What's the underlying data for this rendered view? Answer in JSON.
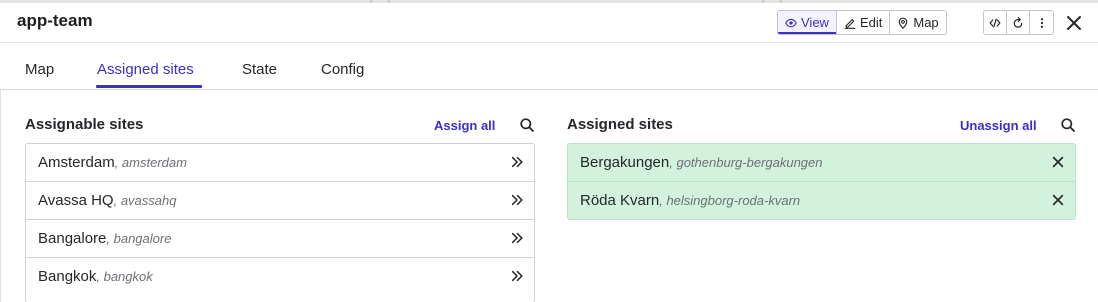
{
  "app": {
    "title": "app-team"
  },
  "view_switch": [
    {
      "label": "View",
      "icon": "eye-icon",
      "active": true
    },
    {
      "label": "Edit",
      "icon": "pencil-icon",
      "active": false
    },
    {
      "label": "Map",
      "icon": "map-pin-icon",
      "active": false
    }
  ],
  "toolbar_icons": [
    "code-icon",
    "refresh-icon",
    "more-vertical-icon"
  ],
  "tabs": [
    {
      "label": "Map",
      "active": false
    },
    {
      "label": "Assigned sites",
      "active": true
    },
    {
      "label": "State",
      "active": false
    },
    {
      "label": "Config",
      "active": false
    }
  ],
  "assignable": {
    "title": "Assignable sites",
    "action_label": "Assign all",
    "items": [
      {
        "name": "Amsterdam",
        "slug": ", amsterdam"
      },
      {
        "name": "Avassa HQ",
        "slug": ", avassahq"
      },
      {
        "name": "Bangalore",
        "slug": ", bangalore"
      },
      {
        "name": "Bangkok",
        "slug": ", bangkok"
      }
    ]
  },
  "assigned": {
    "title": "Assigned sites",
    "action_label": "Unassign all",
    "items": [
      {
        "name": "Bergakungen",
        "slug": ", gothenburg-bergakungen"
      },
      {
        "name": "Röda Kvarn",
        "slug": ", helsingborg-roda-kvarn"
      }
    ]
  },
  "colors": {
    "accent": "#3b2fc9",
    "assigned_row_bg": "#d2f2de",
    "text": "#26262b",
    "muted": "#6f6f76"
  }
}
